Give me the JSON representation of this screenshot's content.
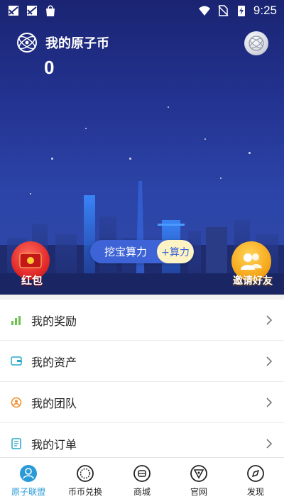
{
  "status_bar": {
    "time": "9:25"
  },
  "header": {
    "title": "我的原子币",
    "coin_value": "0"
  },
  "mining": {
    "label": "挖宝算力",
    "action": "+算力"
  },
  "redpack": {
    "label": "红包"
  },
  "invite": {
    "label": "邀请好友"
  },
  "menu": {
    "items": [
      {
        "label": "我的奖励",
        "icon": "bar-chart-icon"
      },
      {
        "label": "我的资产",
        "icon": "wallet-icon"
      },
      {
        "label": "我的团队",
        "icon": "team-icon"
      },
      {
        "label": "我的订单",
        "icon": "order-icon"
      }
    ]
  },
  "bottom_nav": {
    "items": [
      {
        "label": "原子联盟",
        "icon": "user-circle-icon",
        "active": true
      },
      {
        "label": "币币兑换",
        "icon": "exchange-icon",
        "active": false
      },
      {
        "label": "商城",
        "icon": "shop-icon",
        "active": false
      },
      {
        "label": "官网",
        "icon": "website-icon",
        "active": false
      },
      {
        "label": "发现",
        "icon": "compass-icon",
        "active": false
      }
    ]
  },
  "colors": {
    "accent": "#2a9bd8",
    "hero_top": "#1a2472",
    "hero_bottom": "#2e4aa8",
    "pill": "#3d63d6"
  }
}
